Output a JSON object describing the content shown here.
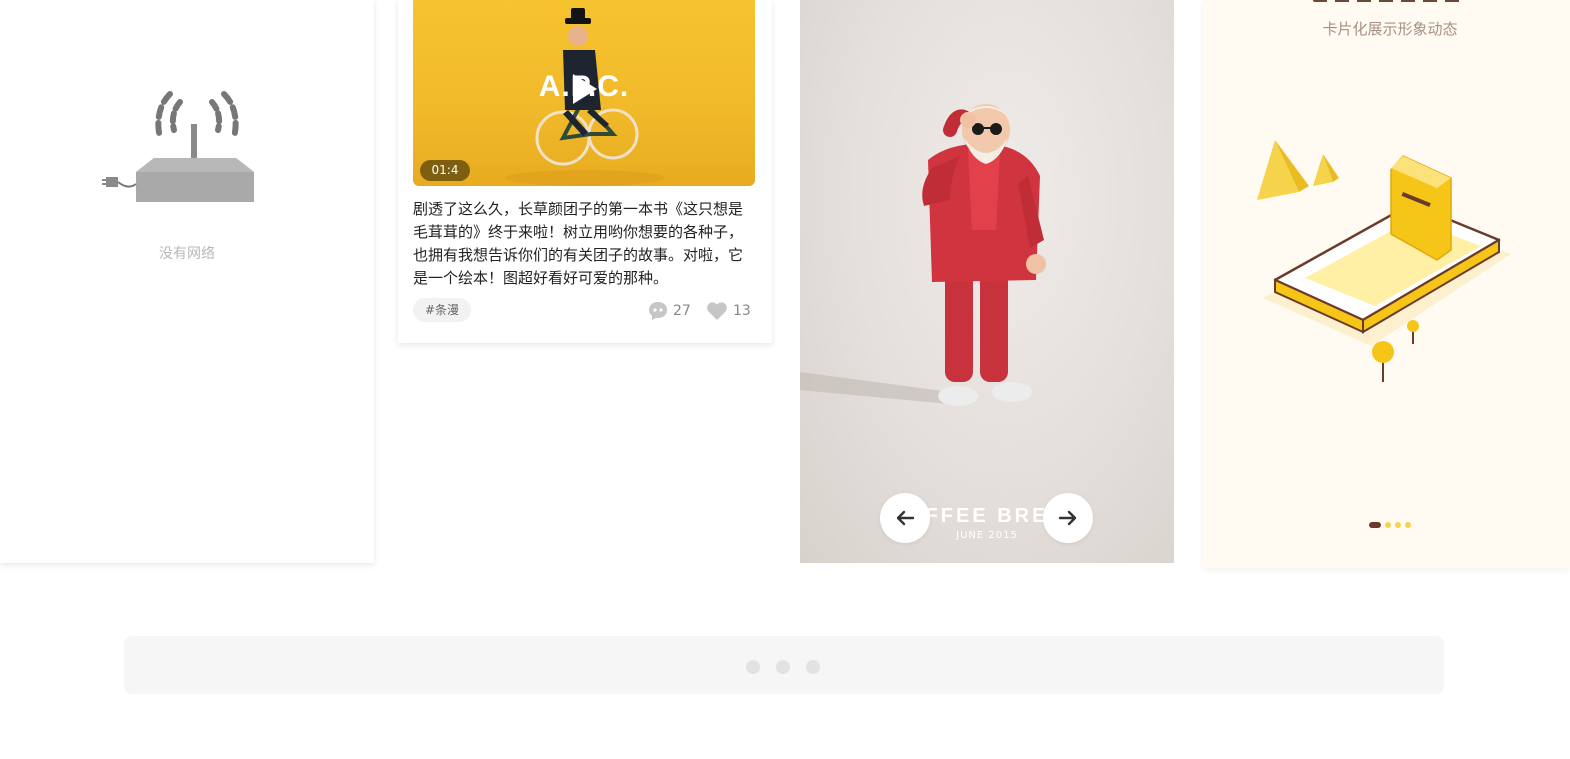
{
  "no_network_card": {
    "message": "没有网络",
    "icon": "router-no-signal-icon"
  },
  "feed_card": {
    "video": {
      "brand_text": "A.P.C.",
      "duration": "01:4",
      "play_icon": "play-icon"
    },
    "text": "剧透了这么久，长草颜团子的第一本书《这只想是毛茸茸的》终于来啦！树立用哟你想要的各种子，也拥有我想告诉你们的有关团子的故事。对啦，它是一个绘本！图超好看好可爱的那种。",
    "tag": "#条漫",
    "comments": {
      "icon": "comment-icon",
      "count": "27"
    },
    "likes": {
      "icon": "heart-icon",
      "count": "13"
    }
  },
  "character_card": {
    "title": "FFEE BRE",
    "date": "JUNE 2015",
    "prev_icon": "arrow-left-icon",
    "next_icon": "arrow-right-icon"
  },
  "onboarding_card": {
    "subtitle": "卡片化展示形象动态",
    "pager": {
      "total": 4,
      "active_index": 0
    },
    "colors": {
      "accent": "#f5d34a",
      "active": "#6b3b2a"
    }
  },
  "bottom_bar": {
    "dot_count": 3
  }
}
